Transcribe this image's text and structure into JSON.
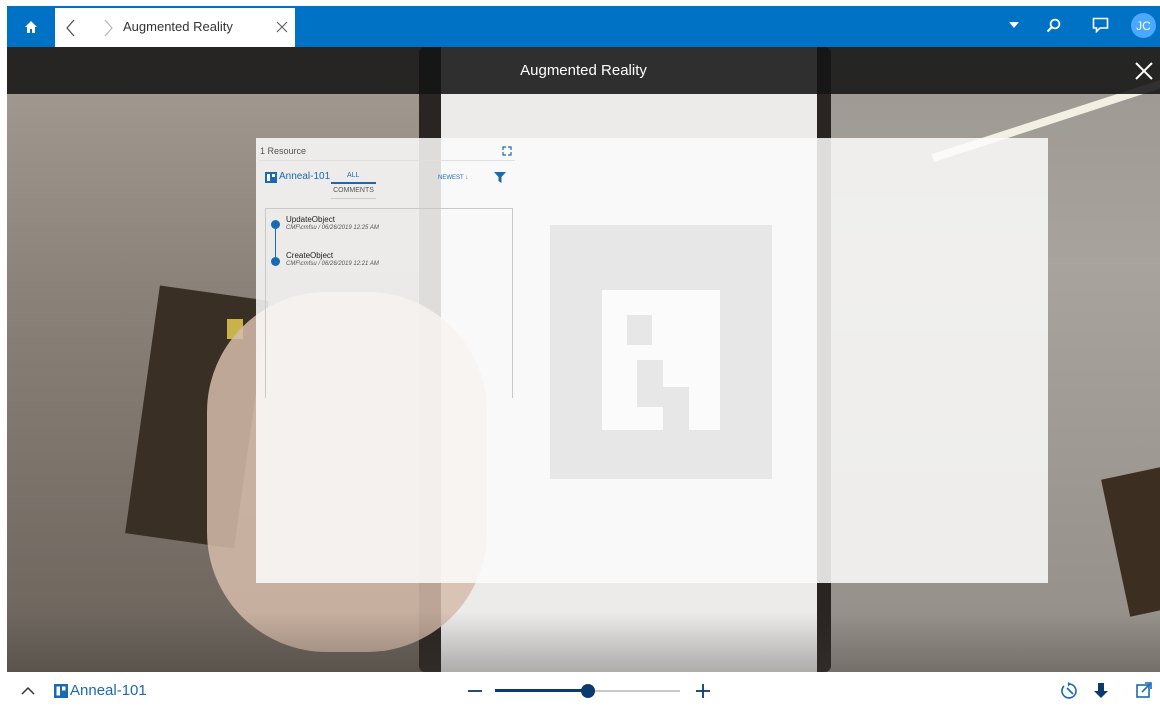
{
  "app": {
    "tab_title": "Augmented Reality",
    "user_initials": "JC",
    "accent_color": "#0072c6"
  },
  "icons": {
    "home": "home-icon",
    "back": "chevron-left-icon",
    "forward": "chevron-right-icon",
    "close_tab": "close-icon",
    "menu": "caret-down-icon",
    "search": "search-icon",
    "feedback": "comment-icon",
    "close_view": "close-icon",
    "expand": "expand-icon",
    "filter": "filter-icon",
    "collapse": "chevron-up-icon",
    "zoom_out": "minus-icon",
    "zoom_in": "plus-icon",
    "reset": "recenter-icon",
    "download": "download-icon",
    "popout": "popout-icon"
  },
  "view": {
    "title": "Augmented Reality"
  },
  "panel": {
    "resource_count": "1 Resource",
    "resource_name": "Anneal-101",
    "tabs": [
      {
        "label": "ALL",
        "active": true
      },
      {
        "label": "COMMENTS",
        "active": false
      }
    ],
    "sort_label": "NEWEST ↓",
    "events": [
      {
        "title": "UpdateObject",
        "meta": "CMF\\cmfsu / 06/26/2019 12:25 AM"
      },
      {
        "title": "CreateObject",
        "meta": "CMF\\cmfsu / 06/26/2019 12:21 AM"
      }
    ]
  },
  "bottom": {
    "resource_name": "Anneal-101",
    "zoom_level": 0.5
  }
}
